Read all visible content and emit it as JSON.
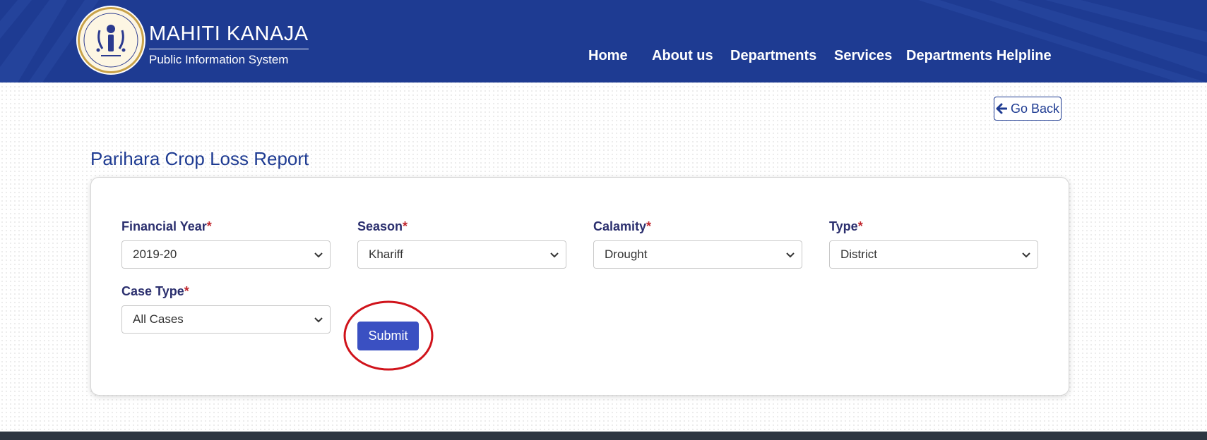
{
  "brand": {
    "title": "MAHITI KANAJA",
    "subtitle": "Public Information System"
  },
  "nav": [
    "Home",
    "About us",
    "Departments",
    "Services",
    "Departments Helpline"
  ],
  "go_back_label": "Go Back",
  "page_title": "Parihara Crop Loss Report",
  "form": {
    "fields": [
      {
        "label": "Financial Year",
        "value": "2019-20"
      },
      {
        "label": "Season",
        "value": "Khariff"
      },
      {
        "label": "Calamity",
        "value": "Drought"
      },
      {
        "label": "Type",
        "value": "District"
      },
      {
        "label": "Case Type",
        "value": "All Cases"
      }
    ],
    "required_mark": "*",
    "submit_label": "Submit"
  },
  "colors": {
    "header": "#1e3b92",
    "accent": "#3a50c2",
    "required": "#c0262d",
    "highlight": "#d0131b"
  }
}
